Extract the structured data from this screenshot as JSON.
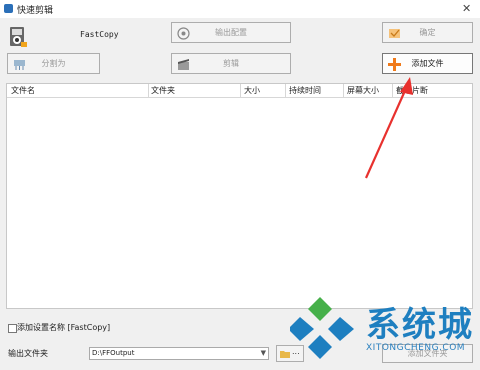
{
  "window": {
    "title": "快速剪辑",
    "close": "✕"
  },
  "source": {
    "name": "FastCopy"
  },
  "toolbar": {
    "output_config": "输出配置",
    "confirm": "确定",
    "split": "分割为",
    "cut": "剪辑",
    "add_file": "添加文件"
  },
  "table": {
    "columns": [
      "文件名",
      "文件夹",
      "大小",
      "持续时间",
      "屏幕大小",
      "截取片断"
    ],
    "rows": []
  },
  "options": {
    "append_name_label": "添加设置名称 [FastCopy]",
    "append_name_checked": false
  },
  "output": {
    "label": "输出文件夹",
    "value": "D:\\FFOutput",
    "browse_label": "...",
    "add_folder_label": "添加文件夹"
  },
  "watermark": {
    "text": "系统城",
    "url": "XITONGCHENG.COM"
  },
  "colors": {
    "accent_arrow": "#e8312e",
    "brand_blue": "#1e7fc0",
    "brand_green": "#46b04a"
  }
}
